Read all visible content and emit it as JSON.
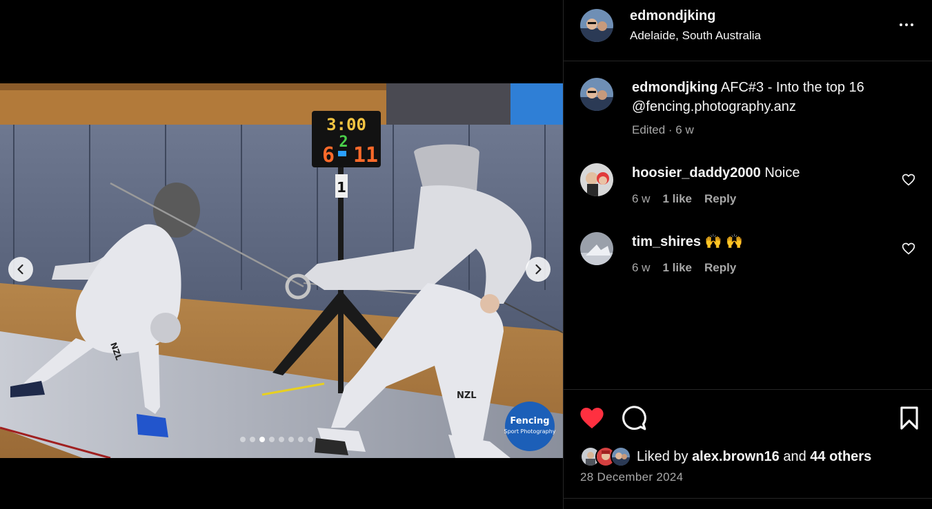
{
  "post": {
    "author": "edmondjking",
    "location": "Adelaide, South Australia",
    "caption": {
      "username": "edmondjking",
      "text": "AFC#3 - Into the top 16 @fencing.photography.anz",
      "meta": "Edited · 6 w"
    },
    "image": {
      "scoreboard_time": "3:00",
      "scoreboard_period": "2",
      "scoreboard_left": "6",
      "scoreboard_right": "11",
      "piste_marker": "1",
      "suit_label_left": "NZL",
      "suit_label_right": "NZL",
      "watermark": "Fencing Sport Photography .com",
      "carousel_count": 8,
      "carousel_active": 2
    }
  },
  "comments": [
    {
      "username": "hoosier_daddy2000",
      "text": "Noice",
      "age": "6 w",
      "likes": "1 like",
      "reply": "Reply"
    },
    {
      "username": "tim_shires",
      "text": "🙌 🙌",
      "age": "6 w",
      "likes": "1 like",
      "reply": "Reply"
    }
  ],
  "likes": {
    "prefix": "Liked by",
    "first_liker": "alex.brown16",
    "joiner": "and",
    "others": "44 others"
  },
  "date": "28 December 2024",
  "icons": {
    "like": "heart-filled-icon",
    "comment": "speech-bubble-icon",
    "save": "bookmark-icon",
    "more": "more-horizontal-icon",
    "prev": "chevron-left-icon",
    "next": "chevron-right-icon"
  },
  "colors": {
    "background": "#000000",
    "text": "#f5f5f5",
    "secondary_text": "#a8a8a8",
    "divider": "#262626",
    "like_red": "#ff3040"
  }
}
